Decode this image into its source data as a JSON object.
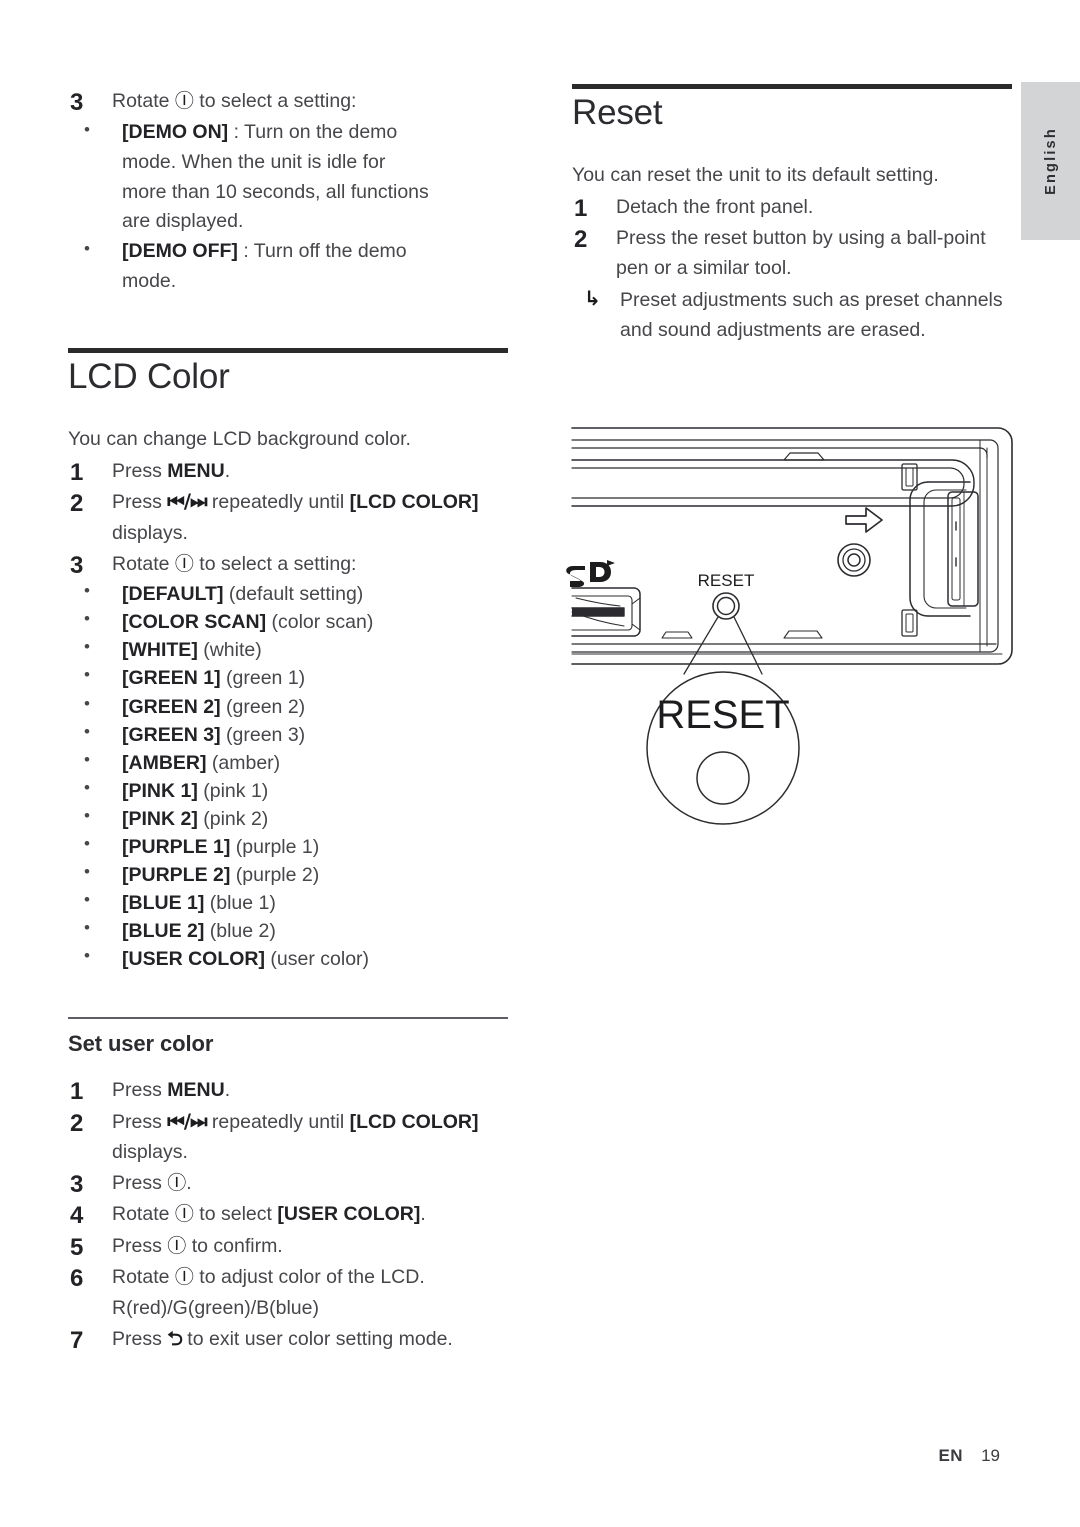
{
  "sidebar": {
    "language_label": "English"
  },
  "left_column": {
    "demo_step": {
      "number": "3",
      "text_before": "Rotate ",
      "symbol": "Ⓘ",
      "text_after": " to select a setting:"
    },
    "demo_bullets": [
      {
        "bold": "[DEMO ON]",
        "rest": " : Turn on the demo",
        "continuation": [
          "mode. When the unit is idle for",
          "more than 10 seconds, all functions",
          "are displayed."
        ]
      },
      {
        "bold": "[DEMO OFF]",
        "rest": " : Turn off the demo",
        "continuation": [
          "mode."
        ]
      }
    ],
    "lcd_color": {
      "title": "LCD Color",
      "intro": "You can change LCD background color.",
      "steps": [
        {
          "number": "1",
          "pre": "Press ",
          "bold": "MENU",
          "post": "."
        },
        {
          "number": "2",
          "pre": "Press ",
          "symbol": "⏮/⏭",
          "mid": " repeatedly until ",
          "bold": "[LCD COLOR]",
          "post": " displays."
        },
        {
          "number": "3",
          "pre": "Rotate ",
          "symbol2": "Ⓘ",
          "post2": " to select a setting:"
        }
      ],
      "options": [
        {
          "code": "[DEFAULT]",
          "desc": "(default setting)"
        },
        {
          "code": "[COLOR SCAN]",
          "desc": "(color scan)"
        },
        {
          "code": "[WHITE]",
          "desc": "(white)"
        },
        {
          "code": "[GREEN 1]",
          "desc": "(green 1)"
        },
        {
          "code": "[GREEN 2]",
          "desc": "(green 2)"
        },
        {
          "code": "[GREEN 3]",
          "desc": "(green 3)"
        },
        {
          "code": "[AMBER]",
          "desc": "(amber)"
        },
        {
          "code": "[PINK 1]",
          "desc": "(pink 1)"
        },
        {
          "code": "[PINK 2]",
          "desc": "(pink 2)"
        },
        {
          "code": "[PURPLE 1]",
          "desc": "(purple 1)"
        },
        {
          "code": "[PURPLE 2]",
          "desc": "(purple 2)"
        },
        {
          "code": "[BLUE 1]",
          "desc": "(blue 1)"
        },
        {
          "code": "[BLUE 2]",
          "desc": "(blue 2)"
        },
        {
          "code": "[USER COLOR]",
          "desc": "(user color)"
        }
      ]
    },
    "set_user_color": {
      "title": "Set user color",
      "steps": [
        {
          "number": "1",
          "pre": "Press ",
          "bold": "MENU",
          "post": "."
        },
        {
          "number": "2",
          "pre": "Press ",
          "symbol": "⏮/⏭",
          "mid": " repeatedly until ",
          "bold": "[LCD COLOR]",
          "post": " displays."
        },
        {
          "number": "3",
          "pre": "Press ",
          "symbol2": "Ⓘ",
          "post2": "."
        },
        {
          "number": "4",
          "pre": "Rotate ",
          "symbol2": "Ⓘ",
          "mid2": " to select ",
          "bold": "[USER COLOR]",
          "post": "."
        },
        {
          "number": "5",
          "pre": "Press ",
          "symbol2": "Ⓘ",
          "post2": " to confirm."
        },
        {
          "number": "6",
          "pre": "Rotate ",
          "symbol2": "Ⓘ",
          "post2": " to adjust color of the LCD.",
          "line2": "R(red)/G(green)/B(blue)"
        },
        {
          "number": "7",
          "pre": "Press ",
          "symbol3": "⮌",
          "post2": " to exit user color setting mode."
        }
      ]
    }
  },
  "right_column": {
    "reset": {
      "title": "Reset",
      "intro": "You can reset the unit to its default setting.",
      "steps": [
        {
          "number": "1",
          "text": "Detach the front panel."
        },
        {
          "number": "2",
          "text": "Press the reset button by using a ball-point pen or a similar tool."
        }
      ],
      "note": "Preset adjustments such as preset channels and sound adjustments are erased."
    },
    "illustration": {
      "sd_label": "SD",
      "reset_small_label": "RESET",
      "reset_callout_label": "RESET"
    }
  },
  "footer": {
    "locale": "EN",
    "page": "19"
  }
}
